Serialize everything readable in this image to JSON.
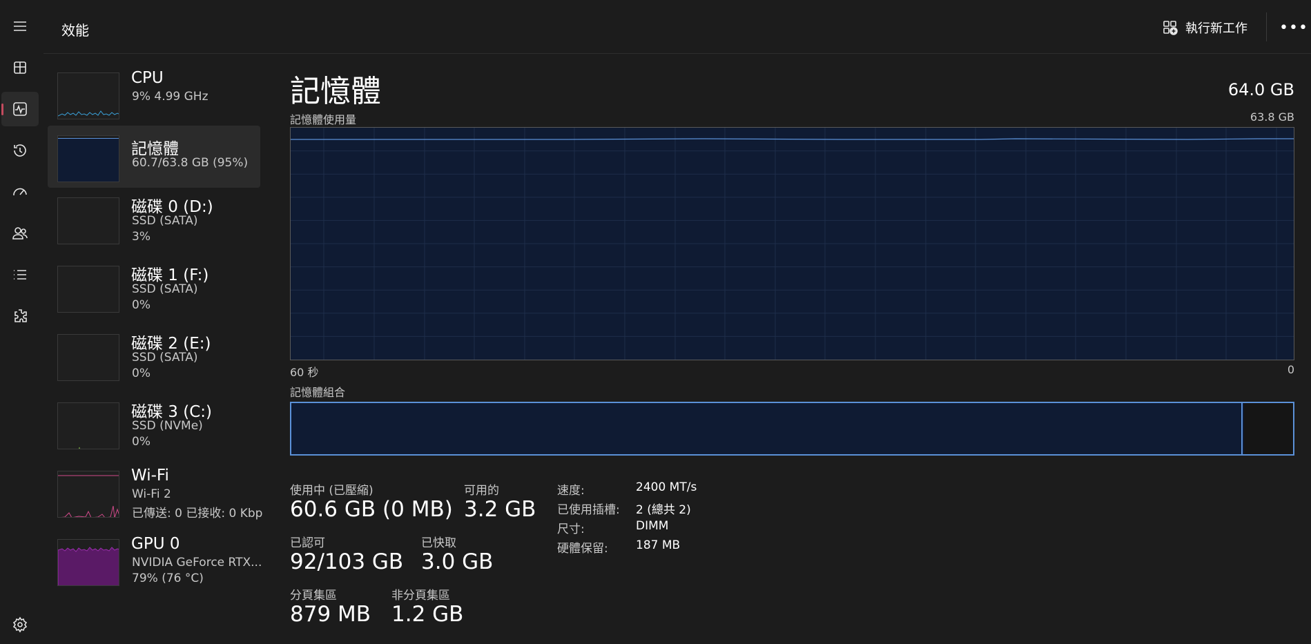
{
  "header": {
    "title": "效能",
    "run_new_task": "執行新工作",
    "more": "•••"
  },
  "rail": {
    "items": [
      "menu-icon",
      "processes-icon",
      "performance-icon",
      "app-history-icon",
      "startup-icon",
      "users-icon",
      "details-icon",
      "services-icon",
      "settings-icon"
    ],
    "active": "performance-icon",
    "active_color": "#c34b5e"
  },
  "resources": [
    {
      "name": "CPU",
      "line1": "9%  4.99 GHz",
      "line2": "",
      "graph_color": "#3aa0d8"
    },
    {
      "name": "記憶體",
      "line1": "60.7/63.8 GB (95%)",
      "line2": "",
      "graph_color": "#5b91d8",
      "fill": 0.95
    },
    {
      "name": "磁碟 0 (D:)",
      "line1": "SSD (SATA)",
      "line2": "3%"
    },
    {
      "name": "磁碟 1 (F:)",
      "line1": "SSD (SATA)",
      "line2": "0%"
    },
    {
      "name": "磁碟 2 (E:)",
      "line1": "SSD (SATA)",
      "line2": "0%"
    },
    {
      "name": "磁碟 3 (C:)",
      "line1": "SSD (NVMe)",
      "line2": "0%"
    },
    {
      "name": "Wi-Fi",
      "line1": "Wi-Fi 2",
      "line2": "已傳送: 0  已接收: 0 Kbp",
      "graph_color": "#d04a8a"
    },
    {
      "name": "GPU 0",
      "line1": "NVIDIA GeForce RTX...",
      "line2": "79%  (76 °C)",
      "graph_color": "#9b2fae",
      "fill": 0.79
    }
  ],
  "memory": {
    "title": "記憶體",
    "total": "64.0 GB",
    "usage_label": "記憶體使用量",
    "usage_max": "63.8 GB",
    "time_left": "60 秒",
    "time_right": "0",
    "composition_label": "記憶體組合",
    "composition_in_use_fraction": 0.95,
    "stats": {
      "in_use_label": "使用中 (已壓縮)",
      "in_use": "60.6 GB (0 MB)",
      "available_label": "可用的",
      "available": "3.2 GB",
      "committed_label": "已認可",
      "committed": "92/103 GB",
      "cached_label": "已快取",
      "cached": "3.0 GB",
      "paged_label": "分頁集區",
      "paged": "879 MB",
      "nonpaged_label": "非分頁集區",
      "nonpaged": "1.2 GB"
    },
    "details": [
      {
        "key": "速度:",
        "value": "2400 MT/s"
      },
      {
        "key": "已使用插槽:",
        "value": "2 (總共 2)"
      },
      {
        "key": "尺寸:",
        "value": "DIMM"
      },
      {
        "key": "硬體保留:",
        "value": "187 MB"
      }
    ]
  }
}
